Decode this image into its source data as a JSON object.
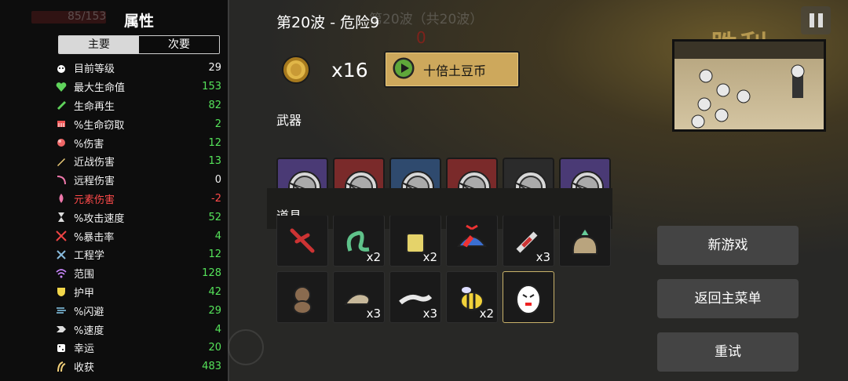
{
  "hud": {
    "hp_text": "85/153"
  },
  "stats": {
    "title": "属性",
    "tabs": [
      {
        "label": "主要",
        "active": true
      },
      {
        "label": "次要",
        "active": false
      }
    ],
    "rows": [
      {
        "icon": "level-icon",
        "label": "目前等级",
        "value": "29",
        "color": "white"
      },
      {
        "icon": "heart-icon",
        "label": "最大生命值",
        "value": "153",
        "color": "green"
      },
      {
        "icon": "regen-icon",
        "label": "生命再生",
        "value": "82",
        "color": "green"
      },
      {
        "icon": "lifesteal-icon",
        "label": "%生命窃取",
        "value": "2",
        "color": "green"
      },
      {
        "icon": "damage-icon",
        "label": "%伤害",
        "value": "12",
        "color": "green"
      },
      {
        "icon": "melee-icon",
        "label": "近战伤害",
        "value": "13",
        "color": "green"
      },
      {
        "icon": "ranged-icon",
        "label": "远程伤害",
        "value": "0",
        "color": "white"
      },
      {
        "icon": "elemental-icon",
        "label": "元素伤害",
        "value": "-2",
        "color": "red"
      },
      {
        "icon": "attack-speed-icon",
        "label": "%攻击速度",
        "value": "52",
        "color": "green"
      },
      {
        "icon": "crit-icon",
        "label": "%暴击率",
        "value": "4",
        "color": "green"
      },
      {
        "icon": "engineering-icon",
        "label": "工程学",
        "value": "12",
        "color": "green"
      },
      {
        "icon": "range-icon",
        "label": "范围",
        "value": "128",
        "color": "green"
      },
      {
        "icon": "armor-icon",
        "label": "护甲",
        "value": "42",
        "color": "green"
      },
      {
        "icon": "dodge-icon",
        "label": "%闪避",
        "value": "29",
        "color": "green"
      },
      {
        "icon": "speed-icon",
        "label": "%速度",
        "value": "4",
        "color": "green"
      },
      {
        "icon": "luck-icon",
        "label": "幸运",
        "value": "20",
        "color": "green"
      },
      {
        "icon": "harvest-icon",
        "label": "收获",
        "value": "483",
        "color": "green"
      }
    ]
  },
  "wave": {
    "title": "第20波 - 危险9",
    "ghost_text": "第20波（共20波）",
    "ghost_zero": "0"
  },
  "currency": {
    "coin_icon": "potato-coin-icon",
    "count": "x16",
    "button_label": "十倍土豆币"
  },
  "sections": {
    "weapons_label": "武器",
    "items_label": "道具"
  },
  "weapons": [
    {
      "tier": "purple",
      "icon": "spear-shield-icon"
    },
    {
      "tier": "red",
      "icon": "spear-shield-icon"
    },
    {
      "tier": "blue",
      "icon": "spear-shield-icon"
    },
    {
      "tier": "red",
      "icon": "spear-shield-icon"
    },
    {
      "tier": "gray",
      "icon": "spear-shield-icon"
    },
    {
      "tier": "purple",
      "icon": "spear-shield-icon"
    }
  ],
  "items_row1": [
    {
      "icon": "red-claw-icon",
      "qty": ""
    },
    {
      "icon": "green-tentacle-icon",
      "qty": "x2"
    },
    {
      "icon": "yellow-cup-icon",
      "qty": "x2"
    },
    {
      "icon": "propeller-cap-icon",
      "qty": ""
    },
    {
      "icon": "syringe-icon",
      "qty": "x3"
    },
    {
      "icon": "sack-icon",
      "qty": ""
    }
  ],
  "items_row2": [
    {
      "icon": "monkey-icon",
      "qty": ""
    },
    {
      "icon": "snail-icon",
      "qty": "x3"
    },
    {
      "icon": "lizard-icon",
      "qty": "x3"
    },
    {
      "icon": "bee-icon",
      "qty": "x2"
    },
    {
      "icon": "egg-face-icon",
      "qty": ""
    }
  ],
  "menu": {
    "new_game": "新游戏",
    "main_menu": "返回主菜单",
    "retry": "重试",
    "banner": "胜利"
  },
  "colors": {
    "gold": "#cda85c",
    "green": "#55e35a",
    "red": "#ff4a4a",
    "button": "#444444"
  }
}
